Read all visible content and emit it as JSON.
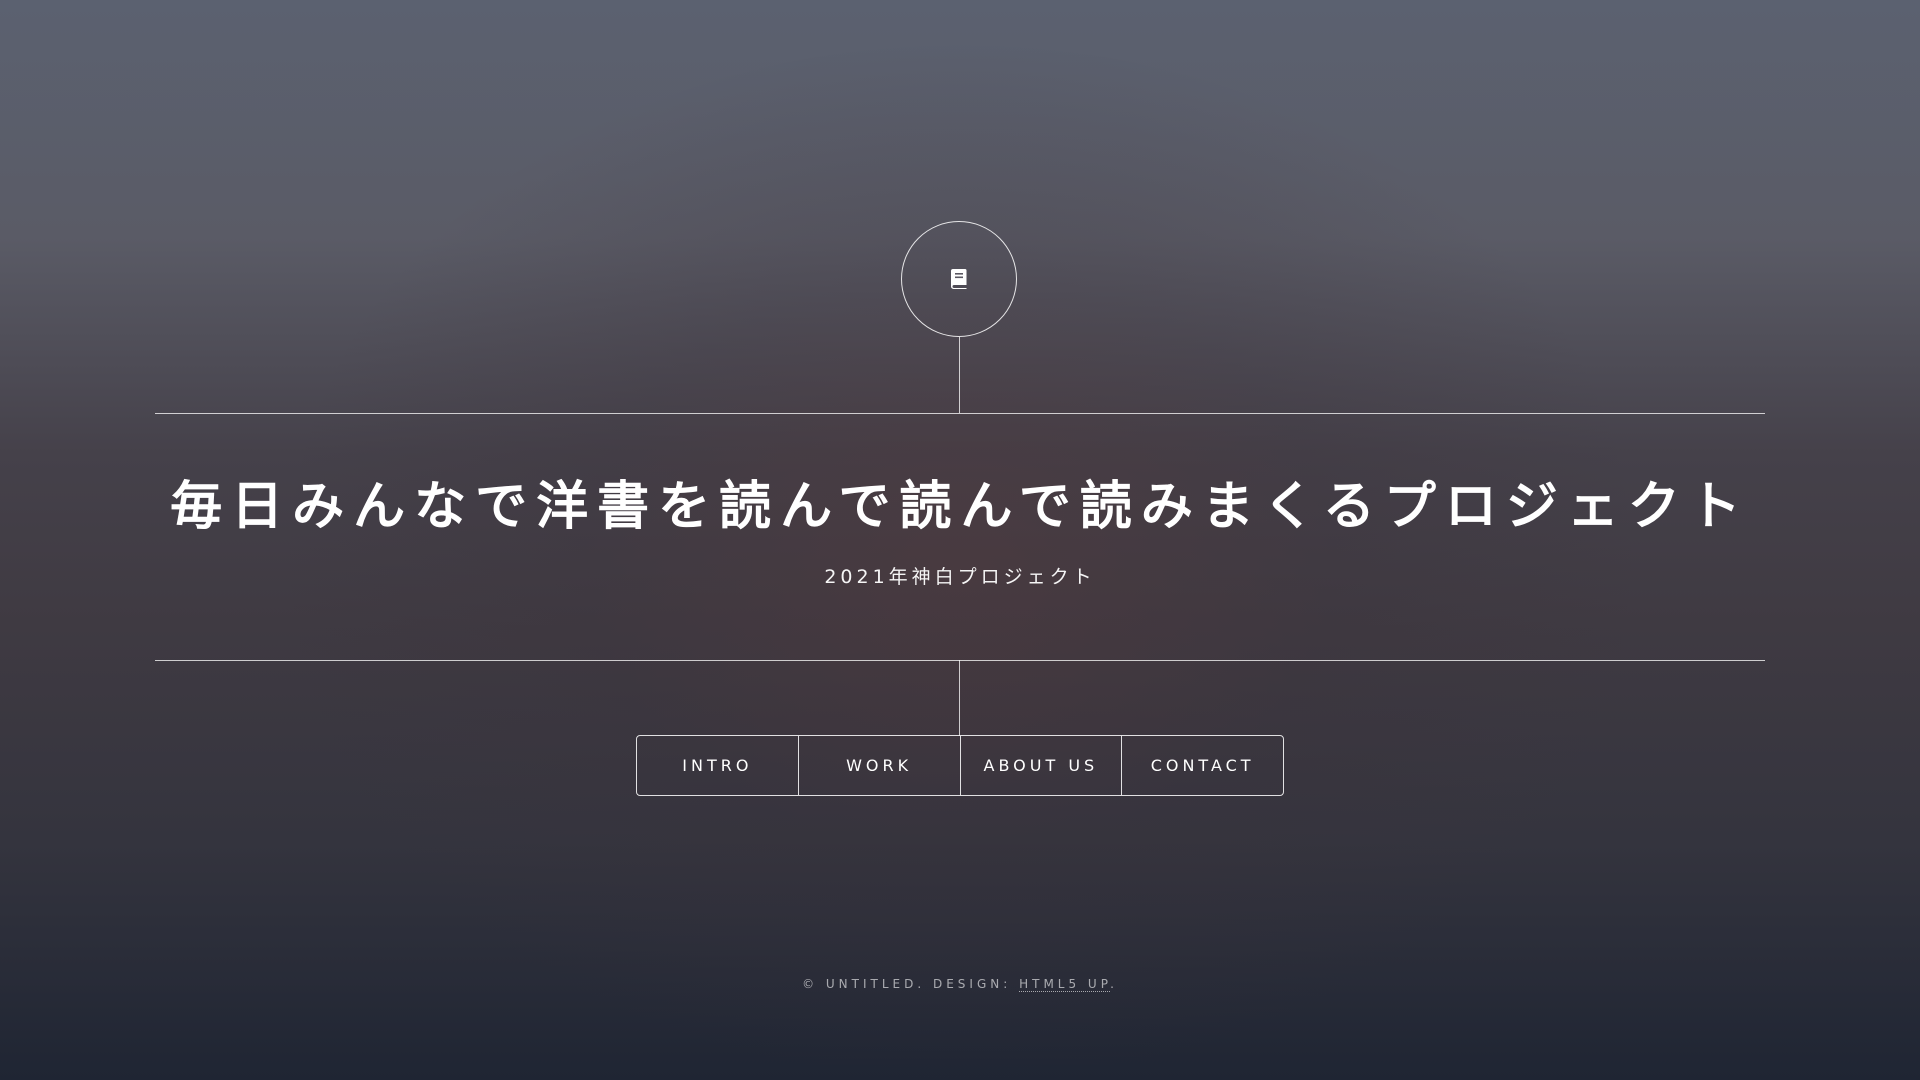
{
  "header": {
    "logo_icon": "book-icon",
    "title": "毎日みんなで洋書を読んで読んで読みまくるプロジェクト",
    "subtitle": "2021年神白プロジェクト"
  },
  "nav": {
    "items": [
      {
        "label": "INTRO"
      },
      {
        "label": "WORK"
      },
      {
        "label": "ABOUT US"
      },
      {
        "label": "CONTACT"
      }
    ]
  },
  "footer": {
    "copyright": "© UNTITLED. DESIGN: ",
    "credit_link": "HTML5 UP",
    "end_punct": "."
  }
}
